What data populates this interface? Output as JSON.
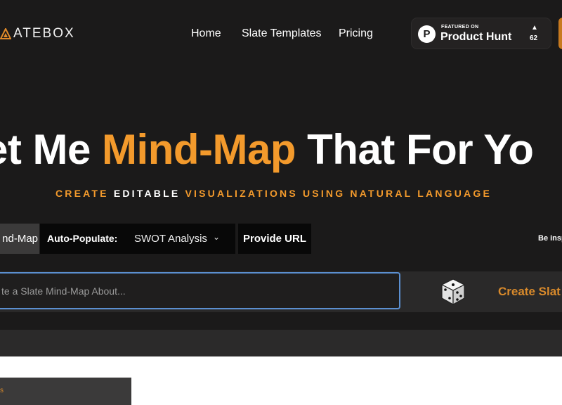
{
  "brand": {
    "name": "ATEBOX"
  },
  "nav": {
    "home": "Home",
    "templates": "Slate Templates",
    "pricing": "Pricing"
  },
  "product_hunt": {
    "featured": "FEATURED ON",
    "name": "Product Hunt",
    "letter": "P",
    "upvotes": "62"
  },
  "hero": {
    "part1": "et Me ",
    "accent": "Mind-Map",
    "part2": " That For Yo",
    "sub": {
      "w1": "CREATE ",
      "w2": "EDITABLE ",
      "w3": "VISUALIZATIONS USING NATURAL LANGUAGE"
    }
  },
  "toolbar": {
    "mode_label": "nd-Map",
    "autopop_label": "Auto-Populate:",
    "autopop_value": "SWOT Analysis",
    "url_label": "Provide URL",
    "inspire_text": "Be insp"
  },
  "prompt": {
    "placeholder": "te a Slate Mind-Map About..."
  },
  "create": {
    "label": "Create Slat"
  },
  "card": {
    "text": "s"
  },
  "colors": {
    "accent": "#f39a2c",
    "background": "#1b1a1a",
    "focus_border": "#5b8fd0"
  }
}
